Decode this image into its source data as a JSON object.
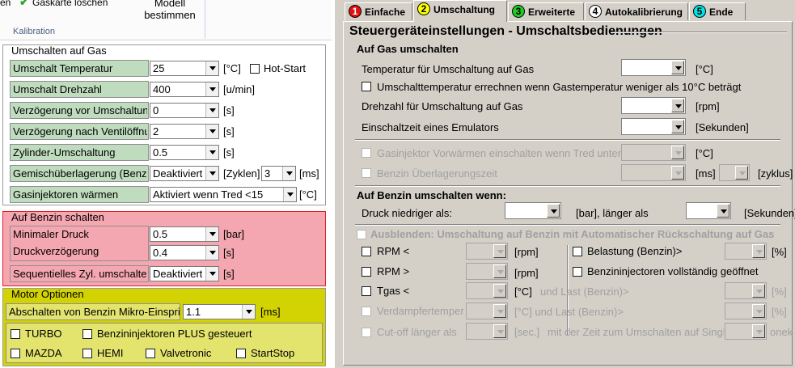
{
  "ribbon": {
    "left_text_1": "en",
    "left_text_2": "Gaskarte löschen",
    "model_button_line1": "Modell",
    "model_button_line2": "bestimmen",
    "group_caption": "Kalibration"
  },
  "gas_group": {
    "title": "Umschalten auf Gas",
    "rows": [
      {
        "label": "Umschalt Temperatur",
        "value": "25",
        "unit": "[°C]",
        "extra_label": "Hot-Start",
        "extra_checked": false
      },
      {
        "label": "Umschalt Drehzahl",
        "value": "400",
        "unit": "[u/min]"
      },
      {
        "label": "Verzögerung vor Umschaltung",
        "value": "0",
        "unit": "[s]"
      },
      {
        "label": "Verzögerung nach Ventilöffnung",
        "value": "2",
        "unit": "[s]"
      },
      {
        "label": "Zylinder-Umschaltung",
        "value": "0.5",
        "unit": "[s]"
      },
      {
        "label": "Gemischüberlagerung (Benzin)",
        "value": "Deaktiviert",
        "unit": "[Zyklen]",
        "value2": "3",
        "unit2": "[ms]"
      },
      {
        "label": "Gasinjektoren wärmen",
        "value": "Aktiviert wenn Tred <15",
        "unit": "[°C]"
      }
    ]
  },
  "benzin_group": {
    "title": "Auf Benzin schalten",
    "rows": [
      {
        "label": "Minimaler Druck",
        "value": "0.5",
        "unit": "[bar]"
      },
      {
        "label": "Druckverzögerung",
        "value": "0.4",
        "unit": "[s]"
      },
      {
        "label": "Sequentielles Zyl. umschalten",
        "value": "Deaktiviert",
        "unit": "[s]"
      }
    ]
  },
  "motor_group": {
    "title": "Motor Optionen",
    "row": {
      "label": "Abschalten von Benzin Mikro-Einspritzung",
      "value": "1.1",
      "unit": "[ms]"
    },
    "checkboxes": [
      {
        "label": "TURBO",
        "checked": false
      },
      {
        "label": "Benzininjektoren PLUS gesteuert",
        "checked": false
      },
      {
        "label": "MAZDA",
        "checked": false
      },
      {
        "label": "HEMI",
        "checked": false
      },
      {
        "label": "Valvetronic",
        "checked": false
      },
      {
        "label": "StartStop",
        "checked": false
      }
    ]
  },
  "tabs": [
    {
      "num": "1",
      "label": "Einfache",
      "color": "#e01010",
      "num_color": "#ffffff",
      "active": false
    },
    {
      "num": "2",
      "label": "Umschaltung",
      "color": "#ffff00",
      "num_color": "#000000",
      "active": true
    },
    {
      "num": "3",
      "label": "Erweiterte",
      "color": "#22cc22",
      "num_color": "#000000",
      "active": false
    },
    {
      "num": "4",
      "label": "Autokalibrierung",
      "color": "#ffffff",
      "num_color": "#000000",
      "active": false
    },
    {
      "num": "5",
      "label": "Ende",
      "color": "#00e5e5",
      "num_color": "#000000",
      "active": false
    }
  ],
  "right": {
    "title": "Steuergeräteinstellungen - Umschaltsbedienungen",
    "sec_gas": "Auf Gas umschalten",
    "temp_label": "Temperatur für Umschaltung auf Gas",
    "temp_unit": "[°C]",
    "calc_label": "Umschalttemperatur errechnen wenn Gastemperatur weniger als 10°C beträgt",
    "rpm_label": "Drehzahl für Umschaltung auf Gas",
    "rpm_unit": "[rpm]",
    "emu_label": "Einschaltzeit eines Emulators",
    "emu_unit": "[Sekunden]",
    "preheat_label": "Gasinjektor Vorwärmen einschalten wenn Tred unter",
    "preheat_unit": "[°C]",
    "overlap_label": "Benzin Überlagerungszeit",
    "overlap_unit": "[ms]",
    "overlap_unit2": "[zyklus]",
    "sec_benzin": "Auf Benzin umschalten wenn:",
    "pressure_label": "Druck niedriger als:",
    "pressure_unit": "[bar], länger als",
    "pressure_unit2": "[Sekunden]",
    "auto_label": "Ausblenden: Umschaltung auf Benzin mit Automatischer Rückschaltung auf Gas",
    "rpm_lt": "RPM <",
    "rpm_gt": "RPM >",
    "rpm_u": "[rpm]",
    "tgas": "Tgas <",
    "tgas_unit": "[°C]",
    "and_load": "und Last (Benzin)>",
    "evap": "Verdampfertemperatur",
    "evap_unit": "[°C] und Last (Benzin)>",
    "cutoff": "Cut-off länger als",
    "cutoff_unit": "[sec.]",
    "cutoff_text": "mit der Zeit zum Umschalten auf Single",
    "cutoff_right": "onek)",
    "load_label": "Belastung (Benzin)>",
    "pct": "[%]",
    "full_open": "Benzininjectoren vollständig geöffnet"
  }
}
